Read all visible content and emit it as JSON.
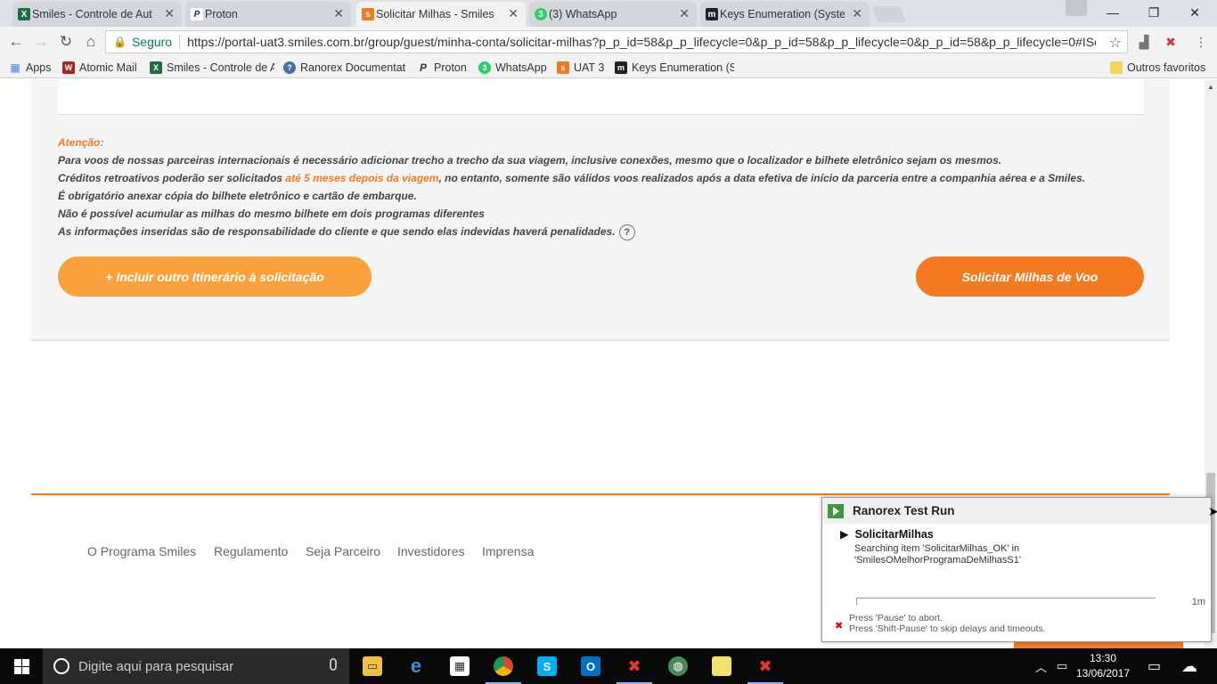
{
  "browser": {
    "tabs": [
      {
        "title": "Smiles - Controle de Aut",
        "icon": "excel-icon",
        "color": "#1d6f42",
        "glyph": "X"
      },
      {
        "title": "Proton",
        "icon": "proton-icon",
        "color": "#555555",
        "glyph": "P"
      },
      {
        "title": "Solicitar Milhas - Smiles",
        "icon": "smiles-icon",
        "color": "#f47920",
        "glyph": "s"
      },
      {
        "title": "(3) WhatsApp",
        "icon": "whatsapp-icon",
        "color": "#25d366",
        "glyph": "3"
      },
      {
        "title": "Keys Enumeration (Syste",
        "icon": "msdn-icon",
        "color": "#222222",
        "glyph": "m"
      }
    ],
    "secure_label": "Seguro",
    "url": "https://portal-uat3.smiles.com.br/group/guest/minha-conta/solicitar-milhas?p_p_id=58&p_p_lifecycle=0&p_p_id=58&p_p_lifecycle=0&p_p_id=58&p_p_lifecycle=0#ISc",
    "bookmarks": [
      {
        "label": "Apps",
        "icon": "apps-icon"
      },
      {
        "label": "Atomic Mail",
        "icon": "atomic-mail-icon"
      },
      {
        "label": "Smiles - Controle de A",
        "icon": "excel-icon"
      },
      {
        "label": "Ranorex Documentati",
        "icon": "ranorex-help-icon"
      },
      {
        "label": "Proton",
        "icon": "proton-icon"
      },
      {
        "label": "WhatsApp",
        "icon": "whatsapp-icon"
      },
      {
        "label": "UAT 3",
        "icon": "smiles-icon"
      },
      {
        "label": "Keys Enumeration (Sy",
        "icon": "msdn-icon"
      }
    ],
    "other_bookmarks": "Outros favoritos"
  },
  "page": {
    "attention_title": "Atenção:",
    "attention_line1": "Para voos de nossas parceiras internacionais é necessário adicionar trecho a trecho da sua viagem, inclusive conexões, mesmo que o localizador e bilhete eletrônico sejam os mesmos.",
    "attention_line2_pre": "Créditos retroativos poderão ser solicitados ",
    "attention_line2_highlight": "até 5 meses depois da viagem",
    "attention_line2_post": ", no entanto, somente são válidos voos realizados após a data efetiva de início da parceria entre a companhia aérea e a Smiles.",
    "attention_line3": "É obrigatório anexar cópia do bilhete eletrônico e cartão de embarque.",
    "attention_line4": "Não é possível acumular as milhas do mesmo bilhete em dois programas diferentes",
    "attention_line5": "As informações inseridas são de responsabilidade do cliente e que sendo elas indevidas haverá penalidades.",
    "help_glyph": "?",
    "add_itinerary_button": "+ Incluir outro Itinerário à solicitação",
    "request_miles_button": "Solicitar Milhas de Voo",
    "footer_links": [
      "O Programa Smiles",
      "Regulamento",
      "Seja Parceiro",
      "Investidores",
      "Imprensa"
    ],
    "colors": {
      "accent": "#f47920",
      "accent_light": "#faa13c"
    }
  },
  "ranorex": {
    "title": "Ranorex Test Run",
    "module": "SolicitarMilhas",
    "message": "Searching item 'SolicitarMilhas_OK' in 'SmilesOMelhorProgramaDeMilhasS1'",
    "elapsed": "1m",
    "hint1": "Press 'Pause' to abort.",
    "hint2": "Press 'Shift-Pause' to skip delays and timeouts."
  },
  "taskbar": {
    "search_placeholder": "Digite aqui para pesquisar",
    "time": "13:30",
    "date": "13/06/2017"
  }
}
